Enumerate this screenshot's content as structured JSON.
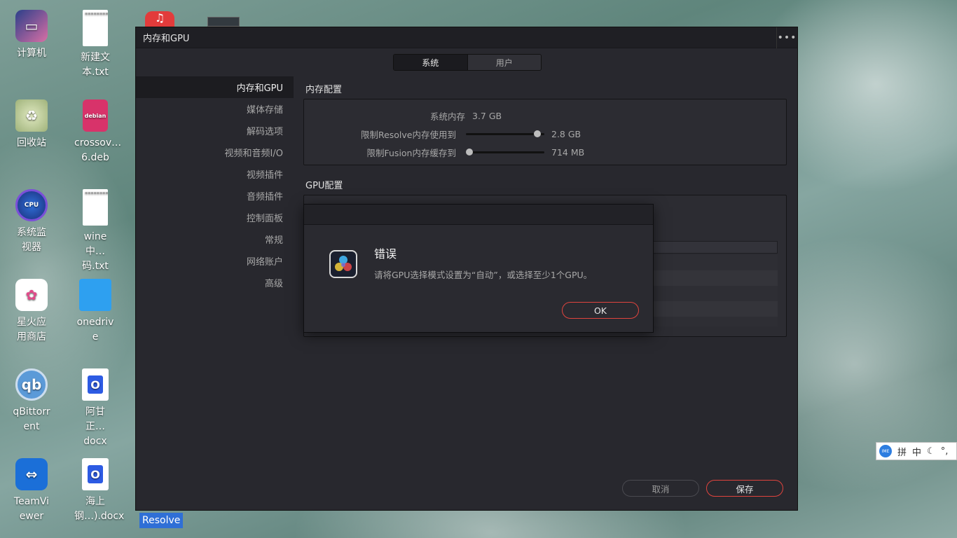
{
  "desktop": {
    "icons": [
      {
        "label": "计算机"
      },
      {
        "label": "新建文本.txt"
      },
      {
        "label": "回收站"
      },
      {
        "label": "crossov…6.deb"
      },
      {
        "label": "系统监视器"
      },
      {
        "label": "wine中…码.txt"
      },
      {
        "label": "星火应用商店"
      },
      {
        "label": "onedrive"
      },
      {
        "label": "qBittorrent"
      },
      {
        "label": "阿甘正…docx"
      },
      {
        "label": "TeamViewer"
      },
      {
        "label": "海上钢…).docx"
      }
    ],
    "taskbar_label": "Resolve",
    "ime": {
      "mode": "拼",
      "lang": "中",
      "punct": "°,"
    }
  },
  "window": {
    "title": "内存和GPU",
    "menu": "•••",
    "tabs": [
      {
        "label": "系统",
        "active": true
      },
      {
        "label": "用户",
        "active": false
      }
    ],
    "sidebar": [
      {
        "label": "内存和GPU",
        "active": true
      },
      {
        "label": "媒体存储"
      },
      {
        "label": "解码选项"
      },
      {
        "label": "视频和音频I/O"
      },
      {
        "label": "视频插件"
      },
      {
        "label": "音频插件"
      },
      {
        "label": "控制面板"
      },
      {
        "label": "常规"
      },
      {
        "label": "网络账户"
      },
      {
        "label": "高级"
      }
    ],
    "memory": {
      "section_title": "内存配置",
      "system_memory_label": "系统内存",
      "system_memory_value": "3.7 GB",
      "resolve_limit_label": "限制Resolve内存使用到",
      "resolve_limit_value": "2.8 GB",
      "resolve_limit_fraction": 0.95,
      "fusion_limit_label": "限制Fusion内存缓存到",
      "fusion_limit_value": "714 MB",
      "fusion_limit_fraction": 0.0
    },
    "gpu": {
      "section_title": "GPU配置"
    },
    "buttons": {
      "cancel": "取消",
      "save": "保存"
    }
  },
  "dialog": {
    "title": "错误",
    "message": "请将GPU选择模式设置为“自动”，或选择至少1个GPU。",
    "ok": "OK"
  }
}
